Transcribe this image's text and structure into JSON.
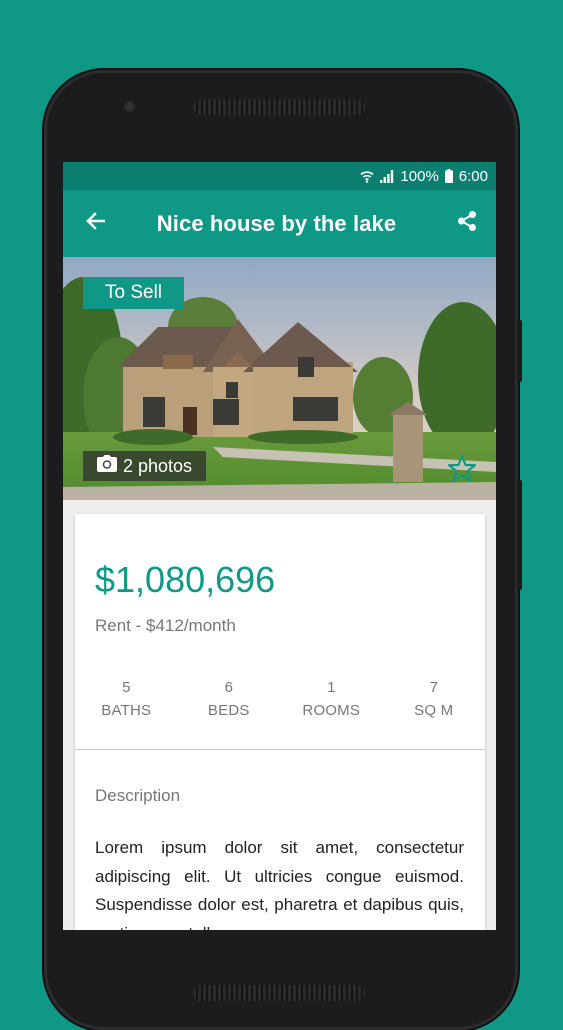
{
  "status_bar": {
    "battery": "100%",
    "time": "6:00"
  },
  "app_bar": {
    "title": "Nice house by the lake"
  },
  "listing": {
    "tag": "To Sell",
    "photos_label": "2 photos",
    "price": "$1,080,696",
    "rent": "Rent - $412/month",
    "stats": [
      {
        "value": "5",
        "label": "BATHS"
      },
      {
        "value": "6",
        "label": "BEDS"
      },
      {
        "value": "1",
        "label": "ROOMS"
      },
      {
        "value": "7",
        "label": "SQ M"
      }
    ],
    "description_title": "Description",
    "description": "Lorem ipsum dolor sit amet, consectetur adipiscing elit. Ut ultricies congue euismod. Suspendisse dolor est, pharetra et dapibus quis, pretium nec tellus."
  },
  "icons": {
    "back": "arrow-back-icon",
    "share": "share-icon",
    "camera": "camera-icon",
    "favorite": "star-outline-icon",
    "wifi": "wifi-icon",
    "signal": "signal-icon",
    "battery": "battery-icon"
  },
  "colors": {
    "primary": "#0f9886",
    "primary_dark": "#0b7e70",
    "background": "#0f9886"
  }
}
